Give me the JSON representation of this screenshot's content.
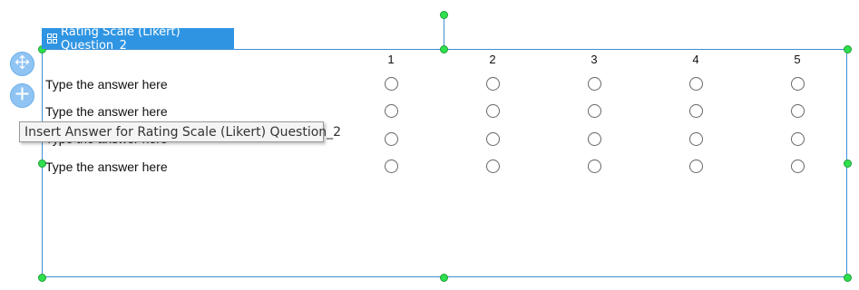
{
  "question": {
    "title": "Rating Scale (Likert) Question_2",
    "title_icon": "grid-icon"
  },
  "scale": {
    "columns": [
      "1",
      "2",
      "3",
      "4",
      "5"
    ]
  },
  "answers": [
    {
      "label": "Type the answer here"
    },
    {
      "label": "Type the answer here"
    },
    {
      "label": "Type the answer here"
    },
    {
      "label": "Type the answer here"
    }
  ],
  "tooltip": {
    "text": "Insert Answer for Rating Scale (Likert) Question_2"
  },
  "tools": {
    "move_icon": "move-icon",
    "add_icon": "plus-icon"
  },
  "colors": {
    "accent": "#2f95e3",
    "frame": "#3c8fd4",
    "handle": "#2ee04d",
    "tool_button": "#90c4f3"
  }
}
